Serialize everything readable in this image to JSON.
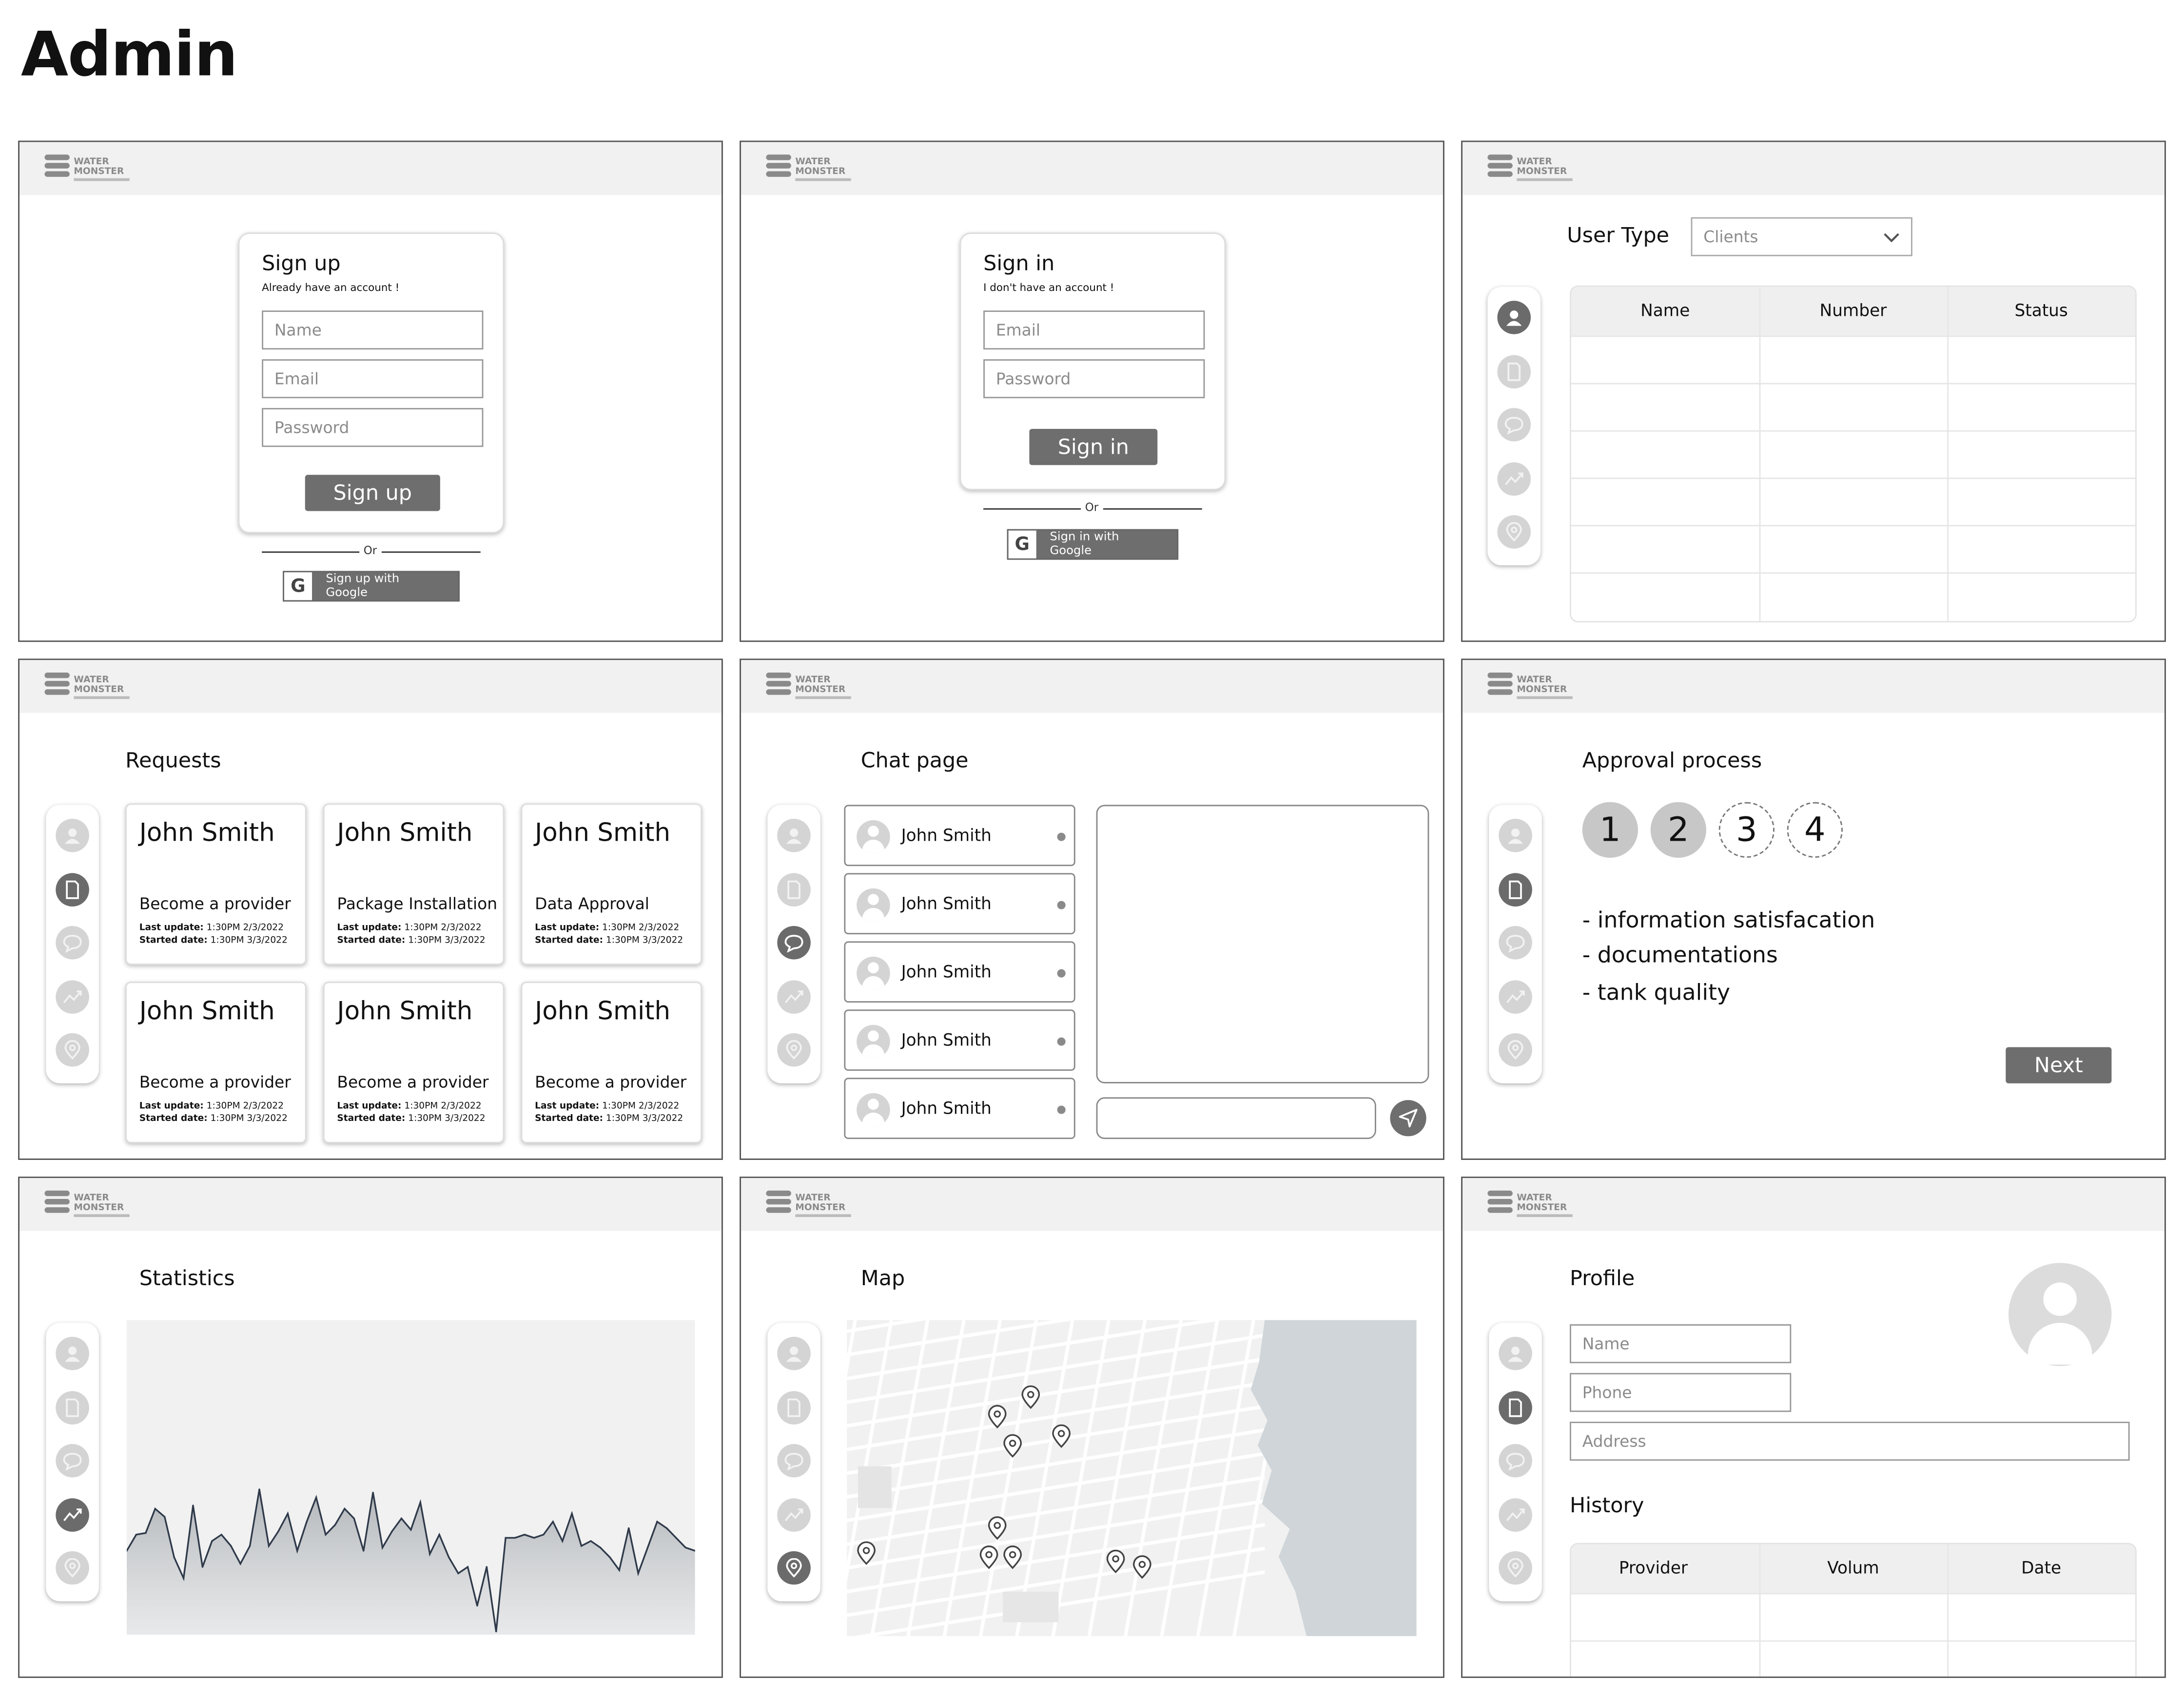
{
  "page_title": "Admin",
  "brand": {
    "line1": "WATER",
    "line2": "MONSTER"
  },
  "signup": {
    "title": "Sign up",
    "subtitle": "Already have an account !",
    "name_ph": "Name",
    "email_ph": "Email",
    "password_ph": "Password",
    "button": "Sign up",
    "or": "Or",
    "google": "Sign up with Google"
  },
  "signin": {
    "title": "Sign in",
    "subtitle": "I don't have an account !",
    "email_ph": "Email",
    "password_ph": "Password",
    "button": "Sign in",
    "or": "Or",
    "google": "Sign in with Google"
  },
  "users": {
    "label": "User Type",
    "select_value": "Clients",
    "columns": [
      "Name",
      "Number",
      "Status"
    ]
  },
  "requests": {
    "title": "Requests",
    "cards": [
      {
        "name": "John Smith",
        "kind": "Become a provider",
        "last_label": "Last update:",
        "last": "1:30PM 2/3/2022",
        "started_label": "Started date:",
        "started": "1:30PM 3/3/2022"
      },
      {
        "name": "John Smith",
        "kind": "Package Installation",
        "last_label": "Last update:",
        "last": "1:30PM 2/3/2022",
        "started_label": "Started date:",
        "started": "1:30PM 3/3/2022"
      },
      {
        "name": "John Smith",
        "kind": "Data Approval",
        "last_label": "Last update:",
        "last": "1:30PM 2/3/2022",
        "started_label": "Started date:",
        "started": "1:30PM 3/3/2022"
      },
      {
        "name": "John Smith",
        "kind": "Become a provider",
        "last_label": "Last update:",
        "last": "1:30PM 2/3/2022",
        "started_label": "Started date:",
        "started": "1:30PM 3/3/2022"
      },
      {
        "name": "John Smith",
        "kind": "Become a provider",
        "last_label": "Last update:",
        "last": "1:30PM 2/3/2022",
        "started_label": "Started date:",
        "started": "1:30PM 3/3/2022"
      },
      {
        "name": "John Smith",
        "kind": "Become a provider",
        "last_label": "Last update:",
        "last": "1:30PM 2/3/2022",
        "started_label": "Started date:",
        "started": "1:30PM 3/3/2022"
      }
    ]
  },
  "chat": {
    "title": "Chat page",
    "contacts": [
      "John Smith",
      "John Smith",
      "John Smith",
      "John Smith",
      "John Smith"
    ]
  },
  "approval": {
    "title": "Approval process",
    "steps": [
      "1",
      "2",
      "3",
      "4"
    ],
    "completed_steps": 2,
    "items": [
      "- information satisfacation",
      "- documentations",
      "- tank quality"
    ],
    "next": "Next"
  },
  "statistics": {
    "title": "Statistics"
  },
  "chart_data": {
    "type": "area",
    "title": "",
    "xlabel": "",
    "ylabel": "",
    "ylim": [
      0,
      100
    ],
    "grid": false,
    "values": [
      52,
      62,
      63,
      78,
      73,
      48,
      35,
      80,
      42,
      58,
      62,
      55,
      44,
      55,
      90,
      55,
      64,
      75,
      52,
      70,
      85,
      62,
      68,
      78,
      72,
      52,
      88,
      54,
      64,
      72,
      65,
      82,
      50,
      62,
      48,
      38,
      42,
      18,
      42,
      2,
      60,
      60,
      62,
      60,
      62,
      70,
      58,
      75,
      55,
      58,
      54,
      48,
      40,
      66,
      38,
      54,
      70,
      66,
      60,
      54,
      52
    ]
  },
  "map": {
    "title": "Map",
    "pins": 10
  },
  "profile": {
    "title": "Profile",
    "name_ph": "Name",
    "phone_ph": "Phone",
    "address_ph": "Address",
    "history_title": "History",
    "columns": [
      "Provider",
      "Volum",
      "Date"
    ]
  },
  "colors": {
    "accent": "#6e6e6e",
    "header_bg": "#f1f1f1",
    "icon_idle": "#d4d4d4",
    "icon_active": "#6b6b6b",
    "chart_line": "#2f3a4a",
    "water": "#cdd3d6",
    "land": "#f1f1f1"
  },
  "icons": [
    "user-icon",
    "document-icon",
    "chat-icon",
    "chart-icon",
    "location-pin-icon",
    "google-icon",
    "send-icon",
    "chevron-down-icon"
  ]
}
